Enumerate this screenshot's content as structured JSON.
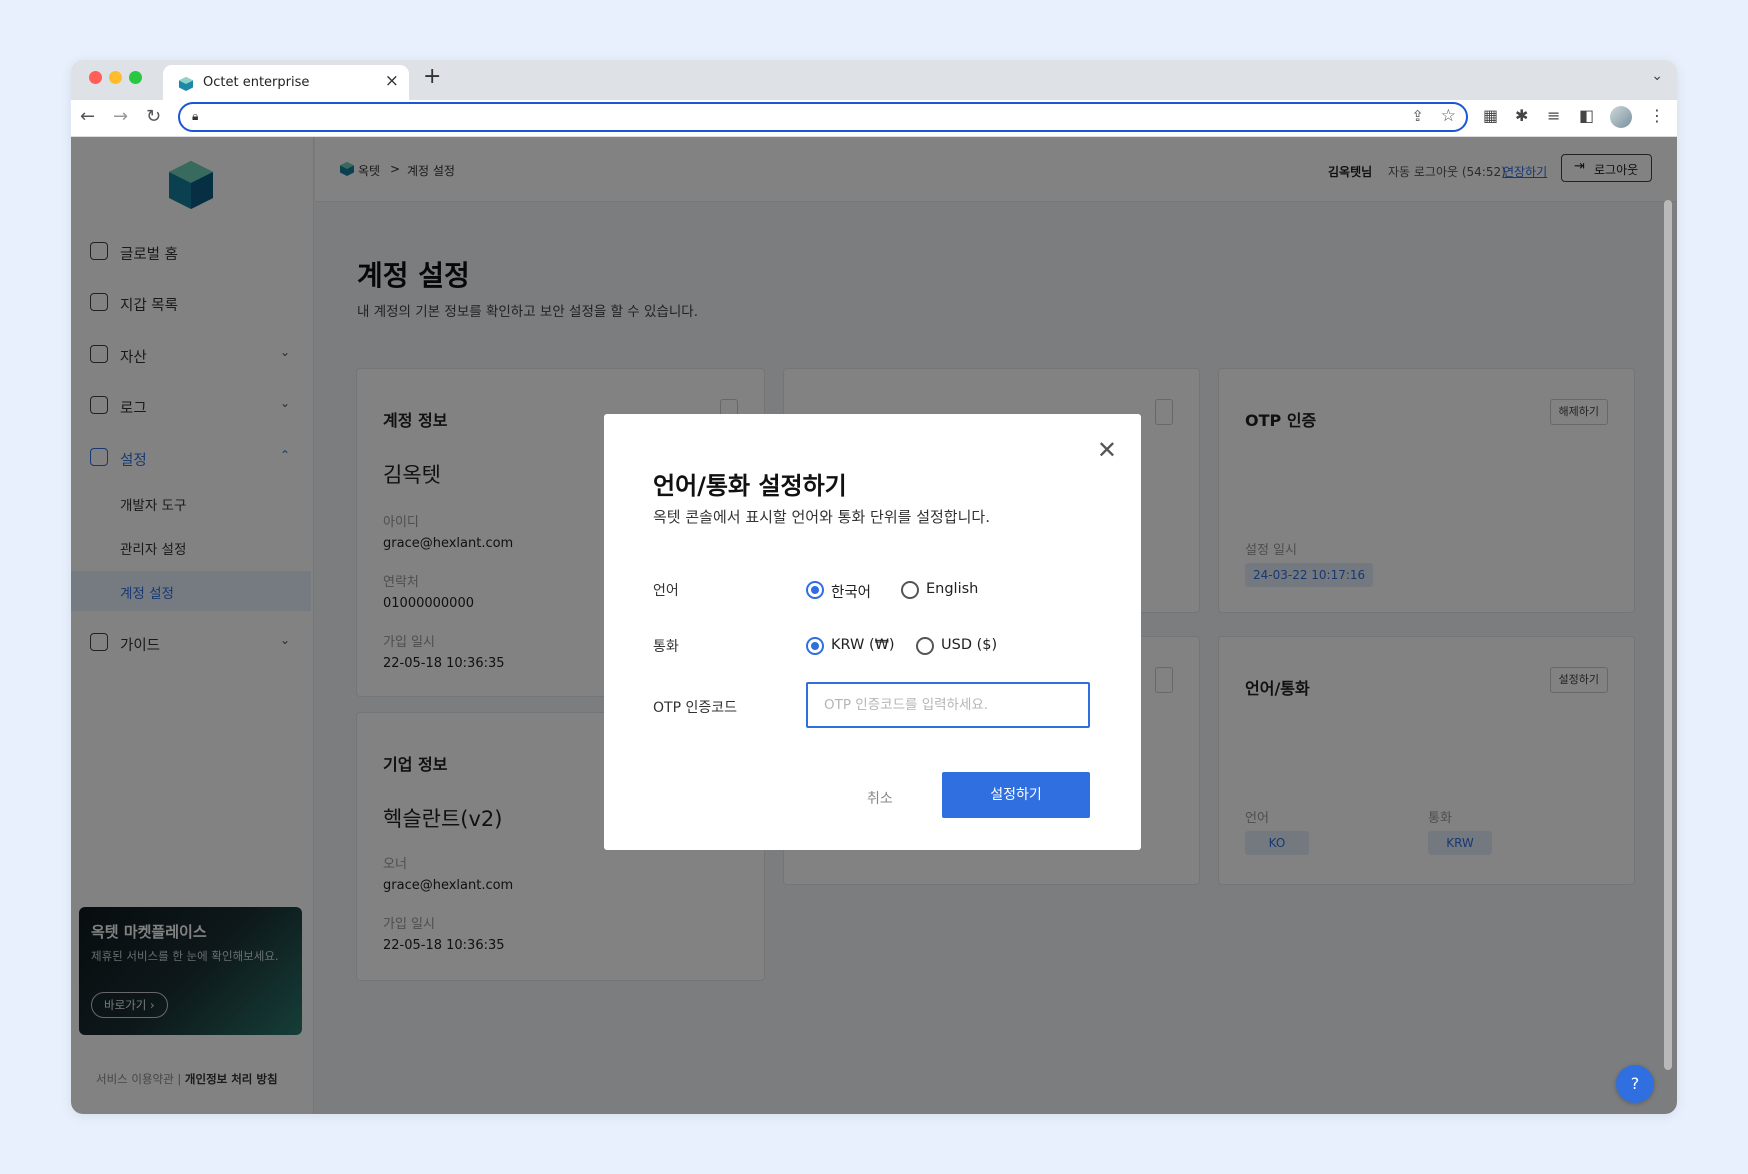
{
  "browser": {
    "tab_title": "Octet enterprise",
    "tab_close": "×",
    "new_tab": "+",
    "url": ""
  },
  "sidebar": {
    "items": [
      {
        "label": "글로벌 홈",
        "icon": "home-icon"
      },
      {
        "label": "지갑 목록",
        "icon": "wallet-list-icon"
      },
      {
        "label": "자산",
        "icon": "asset-icon"
      },
      {
        "label": "로그",
        "icon": "log-icon"
      },
      {
        "label": "설정",
        "icon": "settings-icon"
      },
      {
        "label": "가이드",
        "icon": "guide-icon"
      }
    ],
    "sub_items": [
      "개발자 도구",
      "관리자 설정",
      "계정 설정"
    ],
    "promo": {
      "title": "옥텟 마켓플레이스",
      "desc": "제휴된 서비스를 한 눈에 확인해보세요.",
      "button": "바로가기"
    },
    "footer": {
      "terms": "서비스 이용약관",
      "separator": "|",
      "privacy": "개인정보 처리 방침"
    }
  },
  "header": {
    "breadcrumb": [
      "옥텟",
      "계정 설정"
    ],
    "breadcrumb_sep": ">",
    "user": "김옥텟님",
    "auto_logout": "자동 로그아웃 (54:52)",
    "extend": "연장하기",
    "logout": "로그아웃"
  },
  "page": {
    "title": "계정 설정",
    "description": "내 계정의 기본 정보를 확인하고 보안 설정을 할 수 있습니다."
  },
  "cards": {
    "account": {
      "title": "계정 정보",
      "name": "김옥텟",
      "id_label": "아이디",
      "id_value": "grace@hexlant.com",
      "phone_label": "연락처",
      "phone_value": "01000000000",
      "joined_label": "가입 일시",
      "joined_value": "22-05-18 10:36:35"
    },
    "otp": {
      "title": "OTP 인증",
      "button": "해제하기",
      "date_label": "설정 일시",
      "date_value": "24-03-22 10:17:16"
    },
    "company": {
      "title": "기업 정보",
      "name": "헥슬란트(v2)",
      "owner_label": "오너",
      "owner_value": "grace@hexlant.com",
      "joined_label": "가입 일시",
      "joined_value": "22-05-18 10:36:35"
    },
    "lang": {
      "title": "언어/통화",
      "button": "설정하기",
      "lang_label": "언어",
      "lang_value": "KO",
      "currency_label": "통화",
      "currency_value": "KRW"
    }
  },
  "modal": {
    "title": "언어/통화 설정하기",
    "description": "옥텟 콘솔에서 표시할 언어와 통화 단위를 설정합니다.",
    "language_label": "언어",
    "language_options": [
      "한국어",
      "English"
    ],
    "language_selected": "한국어",
    "currency_label": "통화",
    "currency_options": [
      "KRW (₩)",
      "USD ($)"
    ],
    "currency_selected": "KRW (₩)",
    "otp_label": "OTP 인증코드",
    "otp_value": "",
    "otp_placeholder": "OTP 인증코드를 입력하세요.",
    "cancel": "취소",
    "submit": "설정하기"
  },
  "help": "?"
}
